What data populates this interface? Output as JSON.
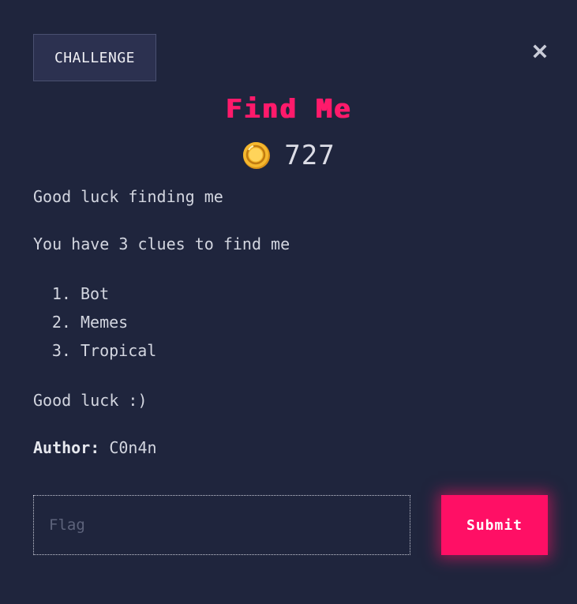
{
  "tab": {
    "label": "CHALLENGE"
  },
  "close": {
    "icon": "close-icon",
    "glyph": "✖"
  },
  "challenge": {
    "title": "Find Me",
    "points_icon": "coin-icon",
    "points": "727",
    "description": {
      "intro": "Good luck finding me",
      "clues_text": "You have 3 clues to find me",
      "clues": [
        "Bot",
        "Memes",
        "Tropical"
      ],
      "outro": "Good luck :)"
    },
    "author_label": "Author:",
    "author_name": "C0n4n"
  },
  "form": {
    "flag_placeholder": "Flag",
    "flag_value": "",
    "submit_label": "Submit"
  },
  "colors": {
    "background": "#1f253d",
    "accent": "#ff0f65",
    "title": "#ff1a6b",
    "coin": "#f5b82e"
  }
}
